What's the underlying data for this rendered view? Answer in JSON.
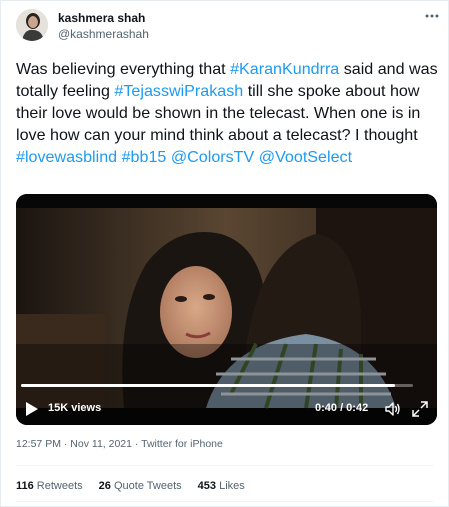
{
  "tweet": {
    "author_name": "kashmera shah",
    "author_handle": "@kashmerashah",
    "text_parts": [
      {
        "t": "Was believing everything that ",
        "link": false
      },
      {
        "t": "#KaranKundrra",
        "link": true
      },
      {
        "t": " said and was totally feeling ",
        "link": false
      },
      {
        "t": "#TejasswiPrakash",
        "link": true
      },
      {
        "t": " till she spoke about how their love would be shown in the telecast. When one is in love how can your mind think about a telecast? I thought ",
        "link": false
      },
      {
        "t": "#lovewasblind",
        "link": true
      },
      {
        "t": " ",
        "link": false
      },
      {
        "t": "#bb15",
        "link": true
      },
      {
        "t": " ",
        "link": false
      },
      {
        "t": "@ColorsTV",
        "link": true
      },
      {
        "t": " ",
        "link": false
      },
      {
        "t": "@VootSelect",
        "link": true
      }
    ],
    "link_color": "#1d9bf0"
  },
  "video": {
    "views": "15K views",
    "time": "0:40 / 0:42",
    "progress": 0.955
  },
  "meta": {
    "time": "12:57 PM",
    "sep1": " · ",
    "date": "Nov 11, 2021",
    "sep2": " · ",
    "source": "Twitter for iPhone"
  },
  "stats": {
    "retweets_count": "116",
    "retweets_label": " Retweets",
    "quotes_count": "26",
    "quotes_label": " Quote Tweets",
    "likes_count": "453",
    "likes_label": " Likes"
  }
}
